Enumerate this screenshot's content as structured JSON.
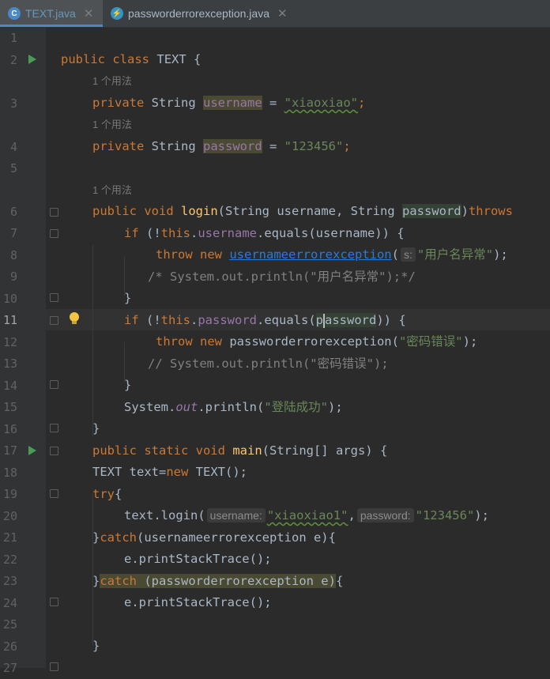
{
  "tabs": [
    {
      "label": "TEXT.java",
      "active": true,
      "icon": "java-class-icon"
    },
    {
      "label": "passworderrorexception.java",
      "active": false,
      "icon": "java-exception-icon"
    }
  ],
  "usage_hint": "1 个用法",
  "inlay": {
    "s": "s:",
    "username": "username:",
    "password": "password:"
  },
  "line_numbers": [
    "1",
    "2",
    "3",
    "4",
    "5",
    "6",
    "7",
    "8",
    "9",
    "10",
    "11",
    "12",
    "13",
    "14",
    "15",
    "16",
    "17",
    "18",
    "19",
    "20",
    "21",
    "22",
    "23",
    "24",
    "25",
    "26",
    "27"
  ],
  "code": {
    "l2": {
      "public": "public",
      "class": "class",
      "name": "TEXT",
      "brace": " {"
    },
    "l3": {
      "private": "private",
      "type": "String",
      "field": "username",
      "eq": " = ",
      "value": "\"xiaoxiao\"",
      "semi": ";"
    },
    "l4": {
      "private": "private",
      "type": "String",
      "field": "password",
      "eq": " = ",
      "value": "\"123456\"",
      "semi": ";"
    },
    "l6": {
      "mods": "public void",
      "method": "login",
      "params1": "(String username, String ",
      "param2": "password",
      "close": ")",
      "throws": "throws"
    },
    "l7": {
      "if": "if",
      "a": " (!",
      "this": "this",
      "dot": ".",
      "field": "username",
      "rest": ".equals(username)) {"
    },
    "l8": {
      "throw": "throw new",
      "cls": "usernameerrorexception",
      "open": "(",
      "str": "\"用户名异常\"",
      "close": ");"
    },
    "l9": {
      "comment": "/* System.out.println(\"用户名异常\");*/"
    },
    "l10": {
      "brace": "}"
    },
    "l11": {
      "if": "if",
      "a": " (!",
      "this": "this",
      "dot": ".",
      "field": "password",
      "rest1": ".equals(",
      "arg1": "p",
      "arg2": "assword",
      "rest2": ")) {"
    },
    "l12": {
      "throw": "throw new",
      "cls": " passworderrorexception(",
      "str": "\"密码错误\"",
      "close": ");"
    },
    "l13": {
      "comment": "// System.out.println(\"密码错误\");"
    },
    "l14": {
      "brace": "}"
    },
    "l15": {
      "a": "System.",
      "out": "out",
      "b": ".println(",
      "str": "\"登陆成功\"",
      "close": ");"
    },
    "l16": {
      "brace": "}"
    },
    "l17": {
      "mods": "public static void",
      "method": "main",
      "rest": "(String[] args) {"
    },
    "l18": {
      "a": "TEXT text=",
      "new": "new",
      "b": " TEXT();"
    },
    "l19": {
      "try": "try",
      "b": "{"
    },
    "l20": {
      "a": "text.login(",
      "s1": "\"xiaoxiao1\"",
      "comma": ",",
      "s2": "\"123456\"",
      "close": ");"
    },
    "l21": {
      "a": "}",
      "catch": "catch",
      "b": "(usernameerrorexception e){"
    },
    "l22": {
      "a": "e.printStackTrace();"
    },
    "l23": {
      "a": "}",
      "catch": "catch",
      "b": " (passworderrorexception e)",
      "c": "{"
    },
    "l24": {
      "a": "e.printStackTrace();"
    },
    "l26": {
      "brace": "}"
    }
  }
}
